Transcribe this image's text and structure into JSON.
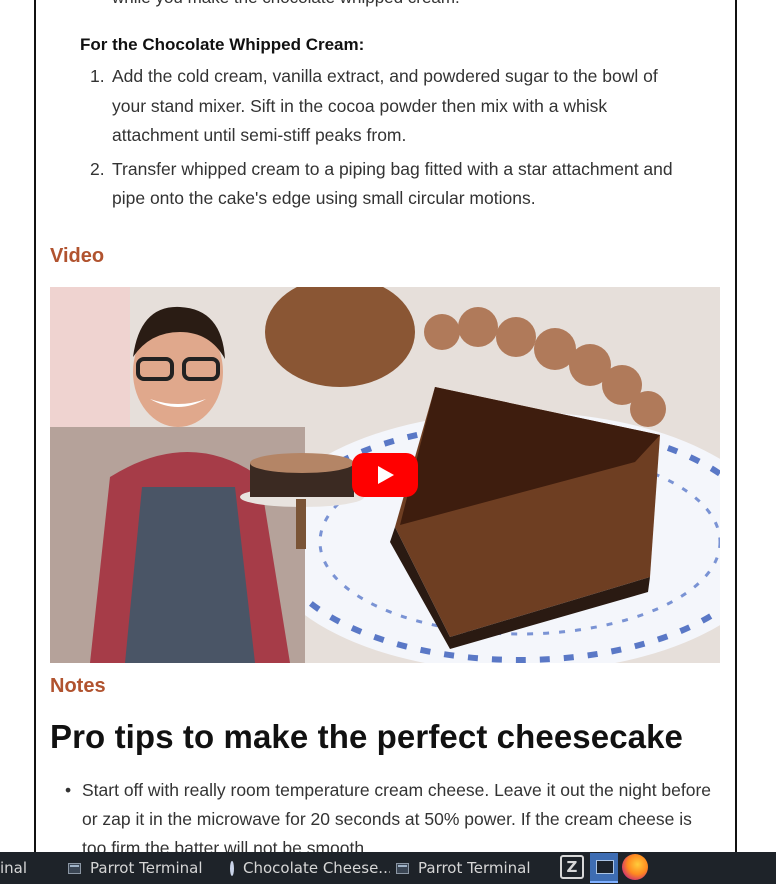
{
  "article": {
    "cut_line": "while you make the chocolate whipped cream.",
    "subhead": "For the Chocolate Whipped Cream:",
    "steps": [
      {
        "num": "1.",
        "text": "Add the cold cream, vanilla extract, and powdered sugar to the bowl of your stand mixer. Sift in the cocoa powder then mix with a whisk attachment until semi-stiff peaks from."
      },
      {
        "num": "2.",
        "text": "Transfer whipped cream to a piping bag fitted with a star attachment and pipe onto the cake's edge using small circular motions."
      }
    ],
    "video_heading": "Video",
    "notes_heading": "Notes",
    "tips_heading": "Pro tips to make the perfect cheesecake",
    "tips": [
      {
        "bullet": "•",
        "text": "Start off with really room temperature cream cheese. Leave it out the night before or zap it in the microwave for 20 seconds at 50% power. If the cream cheese is too firm the batter will not be smooth."
      }
    ]
  },
  "video": {
    "play_icon": "youtube-play-icon",
    "accent": "#ff0000"
  },
  "colors": {
    "section_heading": "#b1532f",
    "body_text": "#333333",
    "taskbar": "#1e2329"
  },
  "taskbar": {
    "items": [
      {
        "label": "inal",
        "icon": "terminal-icon"
      },
      {
        "label": "Parrot Terminal",
        "icon": "terminal-icon"
      },
      {
        "label": "Chocolate Cheese...",
        "icon": "browser-icon"
      },
      {
        "label": "Parrot Terminal",
        "icon": "terminal-icon"
      }
    ]
  }
}
